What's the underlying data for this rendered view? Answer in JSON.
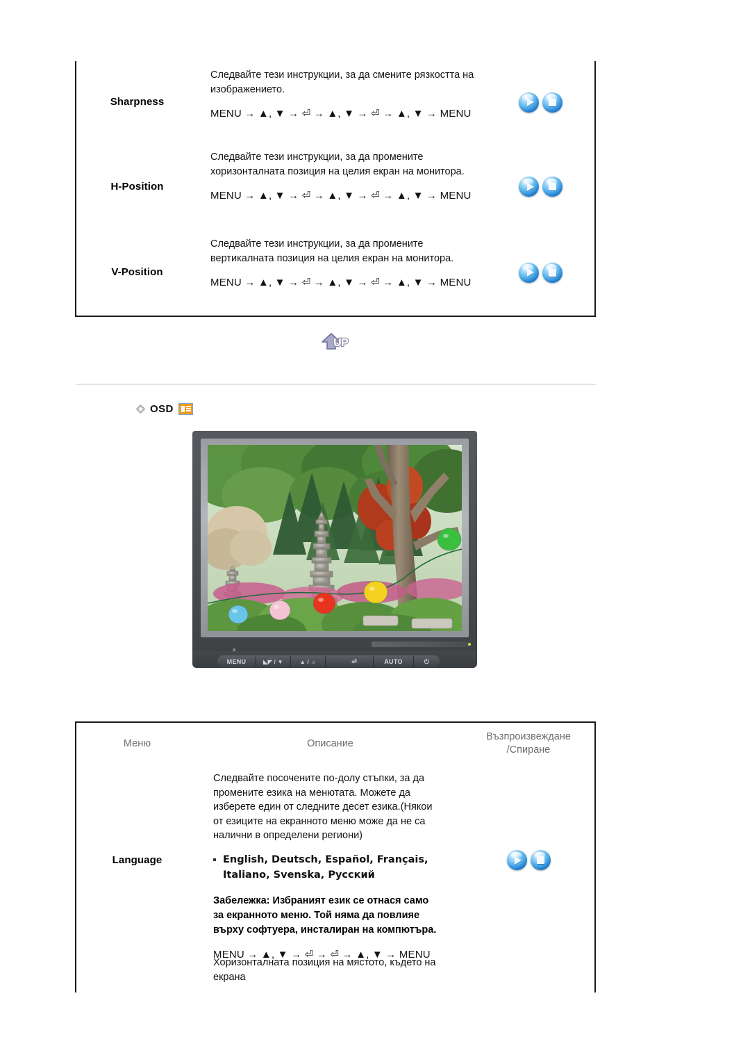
{
  "document": {
    "language": "bg",
    "accent_orange": "#f09a1e",
    "orb_blue": "#1874c8",
    "header_gray": "#6e6e6e"
  },
  "table_top": {
    "rows": [
      {
        "menu": "Sharpness",
        "description": "Следвайте тези инструкции, за да смените рязкостта на изображението.",
        "path": "MENU → ▲, ▼ → ⏎ → ▲, ▼ → ⏎ → ▲, ▼ → MENU",
        "controls": [
          "play-button",
          "stop-button"
        ]
      },
      {
        "menu": "H-Position",
        "description": "Следвайте тези инструкции, за да промените хоризонталната позиция на целия екран на монитора.",
        "path": "MENU → ▲, ▼ → ⏎ → ▲, ▼ → ⏎ → ▲, ▼ → MENU",
        "controls": [
          "play-button",
          "stop-button"
        ]
      },
      {
        "menu": "V-Position",
        "description": "Следвайте тези инструкции, за да промените вертикалната позиция на целия екран на монитора.",
        "path": "MENU → ▲, ▼ → ⏎ → ▲, ▼ → ⏎ → ▲, ▼ → MENU",
        "controls": [
          "play-button",
          "stop-button"
        ]
      }
    ]
  },
  "up_button": {
    "label": "UP",
    "icon": "up-arrow-icon"
  },
  "osd_section": {
    "title": "OSD",
    "bullet": "diamond-bullet-icon",
    "badge": "osd-window-icon"
  },
  "monitor": {
    "name": "lcd-monitor-illustration",
    "screen_content": "garden-photo-with-stone-pagoda-and-lanterns",
    "buttons": [
      {
        "name": "menu-button",
        "label": "MENU"
      },
      {
        "name": "brightness-down-button",
        "label": "◣◤ / ▼"
      },
      {
        "name": "up-brightness-button",
        "label": "▲ / ☼"
      },
      {
        "name": "enter-button",
        "label": "⏎"
      },
      {
        "name": "auto-button",
        "label": "AUTO"
      },
      {
        "name": "power-button",
        "label": "⏻"
      }
    ]
  },
  "table_bottom": {
    "headers": {
      "menu": "Меню",
      "description": "Описание",
      "playstop_line1": "Възпроизвеждане",
      "playstop_line2": "/Спиране"
    },
    "rows": [
      {
        "menu": "Language",
        "description": "Следвайте посочените по-долу стъпки, за да промените езика на менютата. Можете да изберете един от следните десет езика.(Някои от езиците на екранното меню може да не са налични в определени региони)",
        "languages": "English, Deutsch, Español, Français, Italiano, Svenska, Русский",
        "note": "Забележка: Избраният език се отнася само за екранното меню. Той няма да повлияе върху софтуера, инсталиран на компютъра.",
        "path": "MENU → ▲, ▼ → ⏎ → ⏎ → ▲, ▼ → MENU",
        "controls": [
          "play-button",
          "stop-button"
        ]
      },
      {
        "menu": "",
        "description": "Хоризонталната позиция на мястото, където на екрана",
        "controls": []
      }
    ]
  }
}
